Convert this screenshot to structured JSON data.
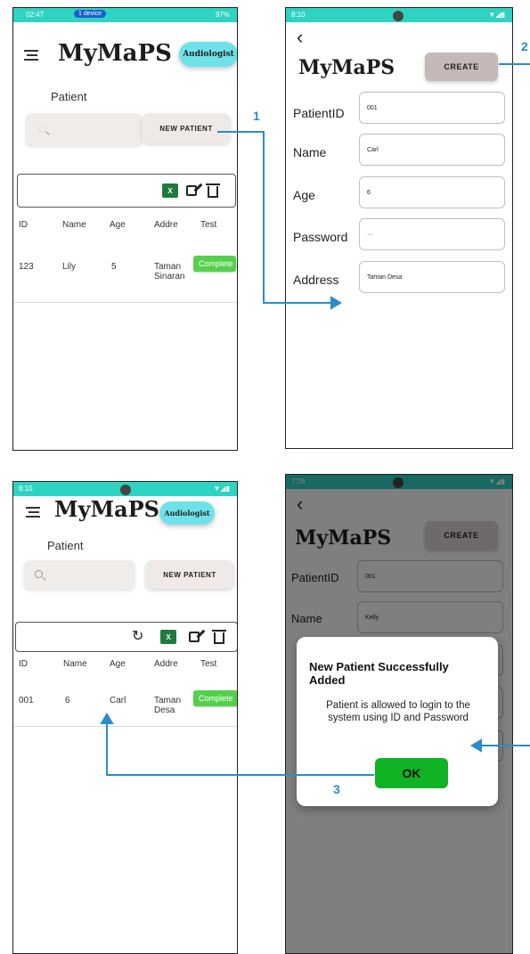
{
  "app": {
    "brand": "MyMaPS"
  },
  "colors": {
    "accent": "#2fd3c2",
    "pill": "#6fe2e9",
    "complete": "#55d04d",
    "ok": "#0fb324",
    "step": "#2a8cc9"
  },
  "screen1": {
    "status": {
      "time": "02:47",
      "device": "1 device",
      "battery": "97%"
    },
    "role": "Audiologist",
    "section": "Patient",
    "new_patient": "NEW PATIENT",
    "table": {
      "headers": [
        "ID",
        "Name",
        "Age",
        "Addre",
        "Test"
      ],
      "rows": [
        {
          "id": "123",
          "name": "Lily",
          "age": "5",
          "address": "Taman Sinaran",
          "test": "Complete"
        }
      ]
    }
  },
  "screen2": {
    "status": {
      "time": "8:10"
    },
    "create": "CREATE",
    "fields": [
      {
        "label": "PatientID",
        "value": "001"
      },
      {
        "label": "Name",
        "value": "Carl"
      },
      {
        "label": "Age",
        "value": "6"
      },
      {
        "label": "Password",
        "value": "···"
      },
      {
        "label": "Address",
        "value": "Taman Desa"
      }
    ]
  },
  "screen3": {
    "status": {
      "time": "8:10"
    },
    "role": "Audiologist",
    "section": "Patient",
    "new_patient": "NEW PATIENT",
    "table": {
      "headers": [
        "ID",
        "Name",
        "Age",
        "Addre",
        "Test"
      ],
      "rows": [
        {
          "id": "001",
          "name": "6",
          "age": "Carl",
          "address": "Taman Desa",
          "test": "Complete"
        }
      ]
    }
  },
  "screen4": {
    "status": {
      "time": "7:26"
    },
    "create": "CREATE",
    "fields": [
      {
        "label": "PatientID",
        "value": "001"
      },
      {
        "label": "Name",
        "value": "Kelly"
      }
    ],
    "dialog": {
      "title": "New Patient Successfully Added",
      "message": "Patient is allowed to login to the system using ID and Password",
      "ok": "OK"
    }
  },
  "steps": [
    "1",
    "2",
    "3"
  ]
}
